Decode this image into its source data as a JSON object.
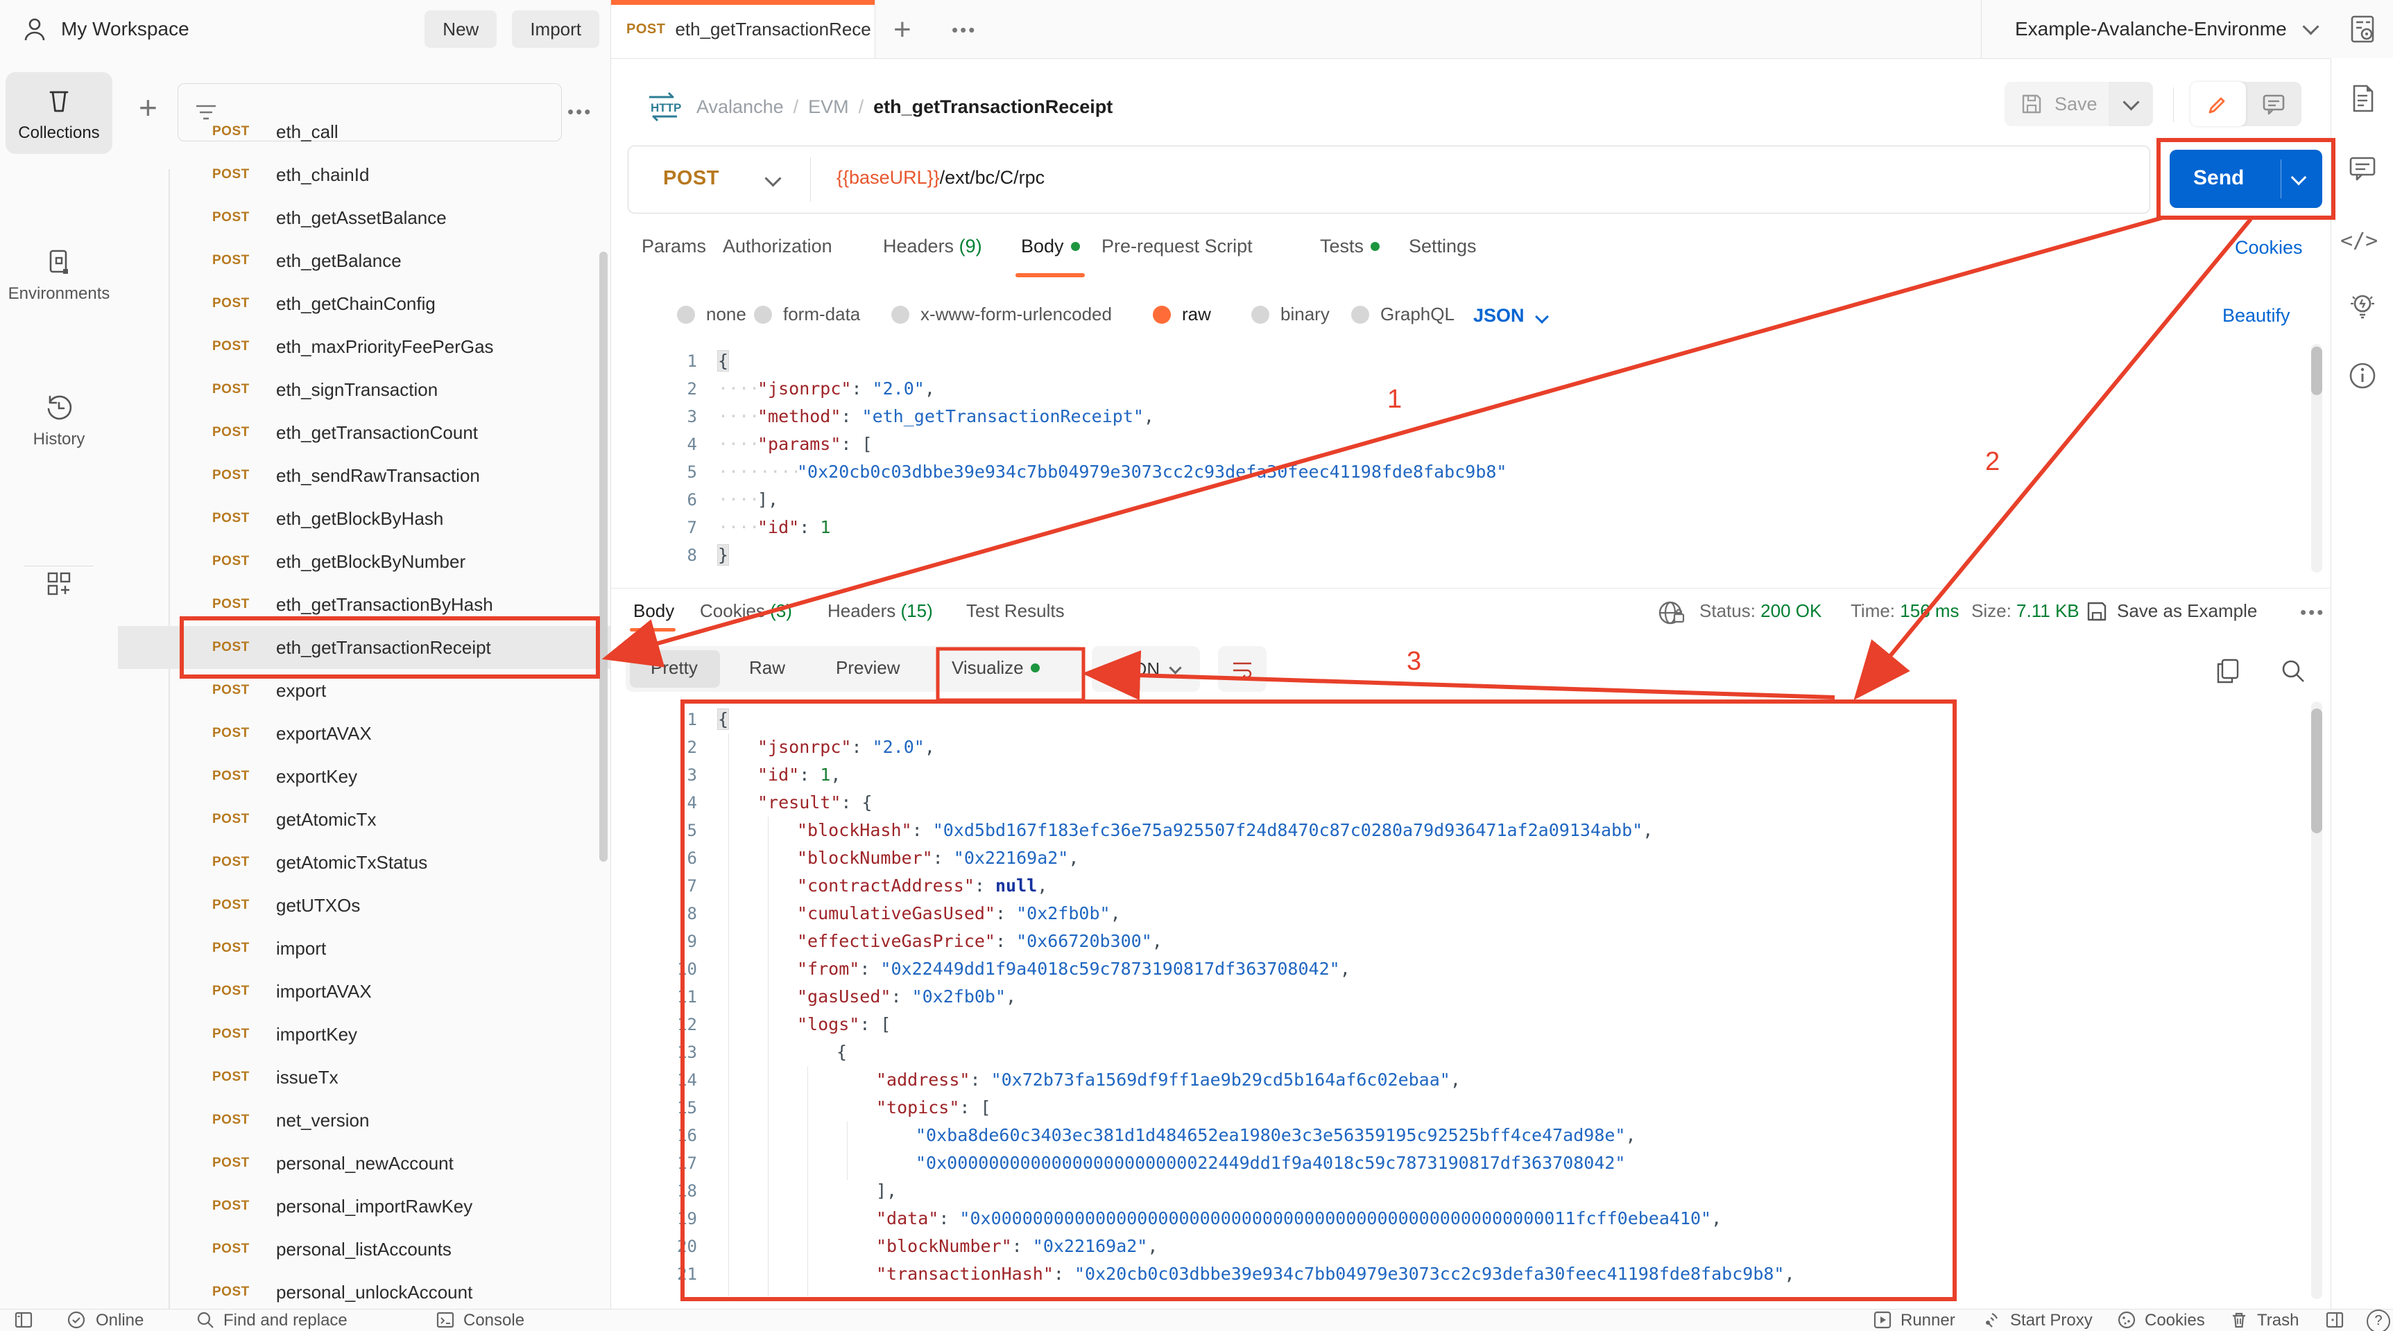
{
  "colors": {
    "accent_orange": "#ff6c37",
    "send_blue": "#0265d2",
    "green": "#007f31",
    "post_amber": "#b7791f",
    "annotation_red": "#e8402a",
    "key_maroon": "#9e2428",
    "string_blue": "#1f66c1"
  },
  "icons": {
    "more": "•••",
    "plus": "+",
    "code": "</>",
    "help": "?",
    "http": "HTTP"
  },
  "top_bar": {
    "workspace_label": "My Workspace",
    "new_label": "New",
    "import_label": "Import",
    "tab": {
      "method": "POST",
      "title": "eth_getTransactionRece"
    },
    "environment_name": "Example-Avalanche-Environme"
  },
  "left_rail": {
    "items": [
      {
        "label": "Collections"
      },
      {
        "label": "Environments"
      },
      {
        "label": "History"
      }
    ]
  },
  "sidebar": {
    "selected_index": 12,
    "items": [
      {
        "method": "POST",
        "name": "eth_call"
      },
      {
        "method": "POST",
        "name": "eth_chainId"
      },
      {
        "method": "POST",
        "name": "eth_getAssetBalance"
      },
      {
        "method": "POST",
        "name": "eth_getBalance"
      },
      {
        "method": "POST",
        "name": "eth_getChainConfig"
      },
      {
        "method": "POST",
        "name": "eth_maxPriorityFeePerGas"
      },
      {
        "method": "POST",
        "name": "eth_signTransaction"
      },
      {
        "method": "POST",
        "name": "eth_getTransactionCount"
      },
      {
        "method": "POST",
        "name": "eth_sendRawTransaction"
      },
      {
        "method": "POST",
        "name": "eth_getBlockByHash"
      },
      {
        "method": "POST",
        "name": "eth_getBlockByNumber"
      },
      {
        "method": "POST",
        "name": "eth_getTransactionByHash"
      },
      {
        "method": "POST",
        "name": "eth_getTransactionReceipt"
      },
      {
        "method": "POST",
        "name": "export"
      },
      {
        "method": "POST",
        "name": "exportAVAX"
      },
      {
        "method": "POST",
        "name": "exportKey"
      },
      {
        "method": "POST",
        "name": "getAtomicTx"
      },
      {
        "method": "POST",
        "name": "getAtomicTxStatus"
      },
      {
        "method": "POST",
        "name": "getUTXOs"
      },
      {
        "method": "POST",
        "name": "import"
      },
      {
        "method": "POST",
        "name": "importAVAX"
      },
      {
        "method": "POST",
        "name": "importKey"
      },
      {
        "method": "POST",
        "name": "issueTx"
      },
      {
        "method": "POST",
        "name": "net_version"
      },
      {
        "method": "POST",
        "name": "personal_newAccount"
      },
      {
        "method": "POST",
        "name": "personal_importRawKey"
      },
      {
        "method": "POST",
        "name": "personal_listAccounts"
      },
      {
        "method": "POST",
        "name": "personal_unlockAccount"
      }
    ]
  },
  "request": {
    "breadcrumb": {
      "part1": "Avalanche",
      "part2": "EVM",
      "separator": "/",
      "current": "eth_getTransactionReceipt"
    },
    "save_label": "Save",
    "method": "POST",
    "url": {
      "variable": "{{baseURL}}",
      "path": "/ext/bc/C/rpc"
    },
    "send_label": "Send",
    "cookies_link": "Cookies",
    "beautify_link": "Beautify",
    "language": "JSON",
    "tabs": [
      {
        "label": "Params"
      },
      {
        "label": "Authorization"
      },
      {
        "label": "Headers",
        "count": "(9)"
      },
      {
        "label": "Body",
        "dot": true,
        "active": true
      },
      {
        "label": "Pre-request Script"
      },
      {
        "label": "Tests",
        "dot": true
      },
      {
        "label": "Settings"
      }
    ],
    "body_modes": [
      "none",
      "form-data",
      "x-www-form-urlencoded",
      "raw",
      "binary",
      "GraphQL"
    ],
    "selected_mode": "raw",
    "code": {
      "lines": [
        {
          "n": "1",
          "i": 0,
          "t": [
            [
              "pb",
              "{"
            ]
          ]
        },
        {
          "n": "2",
          "i": 1,
          "t": [
            [
              "k",
              "\"jsonrpc\""
            ],
            [
              "p",
              ": "
            ],
            [
              "s",
              "\"2.0\""
            ],
            [
              "p",
              ","
            ]
          ]
        },
        {
          "n": "3",
          "i": 1,
          "t": [
            [
              "k",
              "\"method\""
            ],
            [
              "p",
              ": "
            ],
            [
              "s",
              "\"eth_getTransactionReceipt\""
            ],
            [
              "p",
              ","
            ]
          ]
        },
        {
          "n": "4",
          "i": 1,
          "t": [
            [
              "k",
              "\"params\""
            ],
            [
              "p",
              ": "
            ],
            [
              "p",
              "["
            ]
          ]
        },
        {
          "n": "5",
          "i": 2,
          "t": [
            [
              "s",
              "\"0x20cb0c03dbbe39e934c7bb04979e3073cc2c93defa30feec41198fde8fabc9b8\""
            ]
          ]
        },
        {
          "n": "6",
          "i": 1,
          "t": [
            [
              "p",
              "],"
            ]
          ]
        },
        {
          "n": "7",
          "i": 1,
          "t": [
            [
              "k",
              "\"id\""
            ],
            [
              "p",
              ": "
            ],
            [
              "n",
              "1"
            ]
          ]
        },
        {
          "n": "8",
          "i": 0,
          "t": [
            [
              "pb",
              "}"
            ]
          ]
        }
      ]
    }
  },
  "response": {
    "tabs": [
      {
        "label": "Body",
        "active": true
      },
      {
        "label": "Cookies",
        "count": "(3)"
      },
      {
        "label": "Headers",
        "count": "(15)"
      },
      {
        "label": "Test Results"
      }
    ],
    "status_label": "Status:",
    "status_value": "200 OK",
    "time_label": "Time:",
    "time_value": "156 ms",
    "size_label": "Size:",
    "size_value": "7.11 KB",
    "save_as_example": "Save as Example",
    "language": "JSON",
    "view_tabs": [
      {
        "label": "Pretty",
        "active": true
      },
      {
        "label": "Raw"
      },
      {
        "label": "Preview"
      },
      {
        "label": "Visualize",
        "dot": true
      }
    ],
    "code": {
      "lines": [
        {
          "n": "1",
          "i": 0,
          "t": [
            [
              "pb",
              "{"
            ]
          ]
        },
        {
          "n": "2",
          "i": 1,
          "t": [
            [
              "k",
              "\"jsonrpc\""
            ],
            [
              "p",
              ": "
            ],
            [
              "s",
              "\"2.0\""
            ],
            [
              "p",
              ","
            ]
          ]
        },
        {
          "n": "3",
          "i": 1,
          "t": [
            [
              "k",
              "\"id\""
            ],
            [
              "p",
              ": "
            ],
            [
              "n",
              "1"
            ],
            [
              "p",
              ","
            ]
          ]
        },
        {
          "n": "4",
          "i": 1,
          "t": [
            [
              "k",
              "\"result\""
            ],
            [
              "p",
              ": "
            ],
            [
              "p",
              "{"
            ]
          ]
        },
        {
          "n": "5",
          "i": 2,
          "t": [
            [
              "k",
              "\"blockHash\""
            ],
            [
              "p",
              ": "
            ],
            [
              "s",
              "\"0xd5bd167f183efc36e75a925507f24d8470c87c0280a79d936471af2a09134abb\""
            ],
            [
              "p",
              ","
            ]
          ]
        },
        {
          "n": "6",
          "i": 2,
          "t": [
            [
              "k",
              "\"blockNumber\""
            ],
            [
              "p",
              ": "
            ],
            [
              "s",
              "\"0x22169a2\""
            ],
            [
              "p",
              ","
            ]
          ]
        },
        {
          "n": "7",
          "i": 2,
          "t": [
            [
              "k",
              "\"contractAddress\""
            ],
            [
              "p",
              ": "
            ],
            [
              "x",
              "null"
            ],
            [
              "p",
              ","
            ]
          ]
        },
        {
          "n": "8",
          "i": 2,
          "t": [
            [
              "k",
              "\"cumulativeGasUsed\""
            ],
            [
              "p",
              ": "
            ],
            [
              "s",
              "\"0x2fb0b\""
            ],
            [
              "p",
              ","
            ]
          ]
        },
        {
          "n": "9",
          "i": 2,
          "t": [
            [
              "k",
              "\"effectiveGasPrice\""
            ],
            [
              "p",
              ": "
            ],
            [
              "s",
              "\"0x66720b300\""
            ],
            [
              "p",
              ","
            ]
          ]
        },
        {
          "n": "10",
          "i": 2,
          "t": [
            [
              "k",
              "\"from\""
            ],
            [
              "p",
              ": "
            ],
            [
              "s",
              "\"0x22449dd1f9a4018c59c7873190817df363708042\""
            ],
            [
              "p",
              ","
            ]
          ]
        },
        {
          "n": "11",
          "i": 2,
          "t": [
            [
              "k",
              "\"gasUsed\""
            ],
            [
              "p",
              ": "
            ],
            [
              "s",
              "\"0x2fb0b\""
            ],
            [
              "p",
              ","
            ]
          ]
        },
        {
          "n": "12",
          "i": 2,
          "t": [
            [
              "k",
              "\"logs\""
            ],
            [
              "p",
              ": "
            ],
            [
              "p",
              "["
            ]
          ]
        },
        {
          "n": "13",
          "i": 3,
          "t": [
            [
              "p",
              "{"
            ]
          ]
        },
        {
          "n": "14",
          "i": 4,
          "t": [
            [
              "k",
              "\"address\""
            ],
            [
              "p",
              ": "
            ],
            [
              "s",
              "\"0x72b73fa1569df9ff1ae9b29cd5b164af6c02ebaa\""
            ],
            [
              "p",
              ","
            ]
          ]
        },
        {
          "n": "15",
          "i": 4,
          "t": [
            [
              "k",
              "\"topics\""
            ],
            [
              "p",
              ": "
            ],
            [
              "p",
              "["
            ]
          ]
        },
        {
          "n": "16",
          "i": 5,
          "t": [
            [
              "s",
              "\"0xba8de60c3403ec381d1d484652ea1980e3c3e56359195c92525bff4ce47ad98e\""
            ],
            [
              "p",
              ","
            ]
          ]
        },
        {
          "n": "17",
          "i": 5,
          "t": [
            [
              "s",
              "\"0x00000000000000000000000022449dd1f9a4018c59c7873190817df363708042\""
            ]
          ]
        },
        {
          "n": "18",
          "i": 4,
          "t": [
            [
              "p",
              "],"
            ]
          ]
        },
        {
          "n": "19",
          "i": 4,
          "t": [
            [
              "k",
              "\"data\""
            ],
            [
              "p",
              ": "
            ],
            [
              "s",
              "\"0x00000000000000000000000000000000000000000000000000000011fcff0ebea410\""
            ],
            [
              "p",
              ","
            ]
          ]
        },
        {
          "n": "20",
          "i": 4,
          "t": [
            [
              "k",
              "\"blockNumber\""
            ],
            [
              "p",
              ": "
            ],
            [
              "s",
              "\"0x22169a2\""
            ],
            [
              "p",
              ","
            ]
          ]
        },
        {
          "n": "21",
          "i": 4,
          "t": [
            [
              "k",
              "\"transactionHash\""
            ],
            [
              "p",
              ": "
            ],
            [
              "s",
              "\"0x20cb0c03dbbe39e934c7bb04979e3073cc2c93defa30feec41198fde8fabc9b8\""
            ],
            [
              "p",
              ","
            ]
          ]
        }
      ]
    }
  },
  "status_bar": {
    "online": "Online",
    "find_replace": "Find and replace",
    "console": "Console",
    "runner": "Runner",
    "start_proxy": "Start Proxy",
    "cookies": "Cookies",
    "trash": "Trash"
  },
  "annotations": {
    "label_1": "1",
    "label_2": "2",
    "label_3": "3"
  }
}
